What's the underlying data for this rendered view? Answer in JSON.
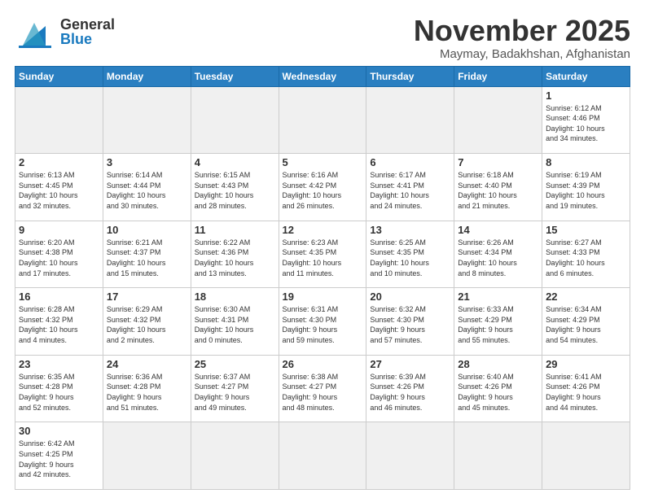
{
  "header": {
    "logo_general": "General",
    "logo_blue": "Blue",
    "month_title": "November 2025",
    "location": "Maymay, Badakhshan, Afghanistan"
  },
  "days_of_week": [
    "Sunday",
    "Monday",
    "Tuesday",
    "Wednesday",
    "Thursday",
    "Friday",
    "Saturday"
  ],
  "weeks": [
    [
      {
        "day": "",
        "info": "",
        "empty": true
      },
      {
        "day": "",
        "info": "",
        "empty": true
      },
      {
        "day": "",
        "info": "",
        "empty": true
      },
      {
        "day": "",
        "info": "",
        "empty": true
      },
      {
        "day": "",
        "info": "",
        "empty": true
      },
      {
        "day": "",
        "info": "",
        "empty": true
      },
      {
        "day": "1",
        "info": "Sunrise: 6:12 AM\nSunset: 4:46 PM\nDaylight: 10 hours\nand 34 minutes.",
        "empty": false
      }
    ],
    [
      {
        "day": "2",
        "info": "Sunrise: 6:13 AM\nSunset: 4:45 PM\nDaylight: 10 hours\nand 32 minutes.",
        "empty": false
      },
      {
        "day": "3",
        "info": "Sunrise: 6:14 AM\nSunset: 4:44 PM\nDaylight: 10 hours\nand 30 minutes.",
        "empty": false
      },
      {
        "day": "4",
        "info": "Sunrise: 6:15 AM\nSunset: 4:43 PM\nDaylight: 10 hours\nand 28 minutes.",
        "empty": false
      },
      {
        "day": "5",
        "info": "Sunrise: 6:16 AM\nSunset: 4:42 PM\nDaylight: 10 hours\nand 26 minutes.",
        "empty": false
      },
      {
        "day": "6",
        "info": "Sunrise: 6:17 AM\nSunset: 4:41 PM\nDaylight: 10 hours\nand 24 minutes.",
        "empty": false
      },
      {
        "day": "7",
        "info": "Sunrise: 6:18 AM\nSunset: 4:40 PM\nDaylight: 10 hours\nand 21 minutes.",
        "empty": false
      },
      {
        "day": "8",
        "info": "Sunrise: 6:19 AM\nSunset: 4:39 PM\nDaylight: 10 hours\nand 19 minutes.",
        "empty": false
      }
    ],
    [
      {
        "day": "9",
        "info": "Sunrise: 6:20 AM\nSunset: 4:38 PM\nDaylight: 10 hours\nand 17 minutes.",
        "empty": false
      },
      {
        "day": "10",
        "info": "Sunrise: 6:21 AM\nSunset: 4:37 PM\nDaylight: 10 hours\nand 15 minutes.",
        "empty": false
      },
      {
        "day": "11",
        "info": "Sunrise: 6:22 AM\nSunset: 4:36 PM\nDaylight: 10 hours\nand 13 minutes.",
        "empty": false
      },
      {
        "day": "12",
        "info": "Sunrise: 6:23 AM\nSunset: 4:35 PM\nDaylight: 10 hours\nand 11 minutes.",
        "empty": false
      },
      {
        "day": "13",
        "info": "Sunrise: 6:25 AM\nSunset: 4:35 PM\nDaylight: 10 hours\nand 10 minutes.",
        "empty": false
      },
      {
        "day": "14",
        "info": "Sunrise: 6:26 AM\nSunset: 4:34 PM\nDaylight: 10 hours\nand 8 minutes.",
        "empty": false
      },
      {
        "day": "15",
        "info": "Sunrise: 6:27 AM\nSunset: 4:33 PM\nDaylight: 10 hours\nand 6 minutes.",
        "empty": false
      }
    ],
    [
      {
        "day": "16",
        "info": "Sunrise: 6:28 AM\nSunset: 4:32 PM\nDaylight: 10 hours\nand 4 minutes.",
        "empty": false
      },
      {
        "day": "17",
        "info": "Sunrise: 6:29 AM\nSunset: 4:32 PM\nDaylight: 10 hours\nand 2 minutes.",
        "empty": false
      },
      {
        "day": "18",
        "info": "Sunrise: 6:30 AM\nSunset: 4:31 PM\nDaylight: 10 hours\nand 0 minutes.",
        "empty": false
      },
      {
        "day": "19",
        "info": "Sunrise: 6:31 AM\nSunset: 4:30 PM\nDaylight: 9 hours\nand 59 minutes.",
        "empty": false
      },
      {
        "day": "20",
        "info": "Sunrise: 6:32 AM\nSunset: 4:30 PM\nDaylight: 9 hours\nand 57 minutes.",
        "empty": false
      },
      {
        "day": "21",
        "info": "Sunrise: 6:33 AM\nSunset: 4:29 PM\nDaylight: 9 hours\nand 55 minutes.",
        "empty": false
      },
      {
        "day": "22",
        "info": "Sunrise: 6:34 AM\nSunset: 4:29 PM\nDaylight: 9 hours\nand 54 minutes.",
        "empty": false
      }
    ],
    [
      {
        "day": "23",
        "info": "Sunrise: 6:35 AM\nSunset: 4:28 PM\nDaylight: 9 hours\nand 52 minutes.",
        "empty": false
      },
      {
        "day": "24",
        "info": "Sunrise: 6:36 AM\nSunset: 4:28 PM\nDaylight: 9 hours\nand 51 minutes.",
        "empty": false
      },
      {
        "day": "25",
        "info": "Sunrise: 6:37 AM\nSunset: 4:27 PM\nDaylight: 9 hours\nand 49 minutes.",
        "empty": false
      },
      {
        "day": "26",
        "info": "Sunrise: 6:38 AM\nSunset: 4:27 PM\nDaylight: 9 hours\nand 48 minutes.",
        "empty": false
      },
      {
        "day": "27",
        "info": "Sunrise: 6:39 AM\nSunset: 4:26 PM\nDaylight: 9 hours\nand 46 minutes.",
        "empty": false
      },
      {
        "day": "28",
        "info": "Sunrise: 6:40 AM\nSunset: 4:26 PM\nDaylight: 9 hours\nand 45 minutes.",
        "empty": false
      },
      {
        "day": "29",
        "info": "Sunrise: 6:41 AM\nSunset: 4:26 PM\nDaylight: 9 hours\nand 44 minutes.",
        "empty": false
      }
    ],
    [
      {
        "day": "30",
        "info": "Sunrise: 6:42 AM\nSunset: 4:25 PM\nDaylight: 9 hours\nand 42 minutes.",
        "empty": false
      },
      {
        "day": "",
        "info": "",
        "empty": true
      },
      {
        "day": "",
        "info": "",
        "empty": true
      },
      {
        "day": "",
        "info": "",
        "empty": true
      },
      {
        "day": "",
        "info": "",
        "empty": true
      },
      {
        "day": "",
        "info": "",
        "empty": true
      },
      {
        "day": "",
        "info": "",
        "empty": true
      }
    ]
  ]
}
